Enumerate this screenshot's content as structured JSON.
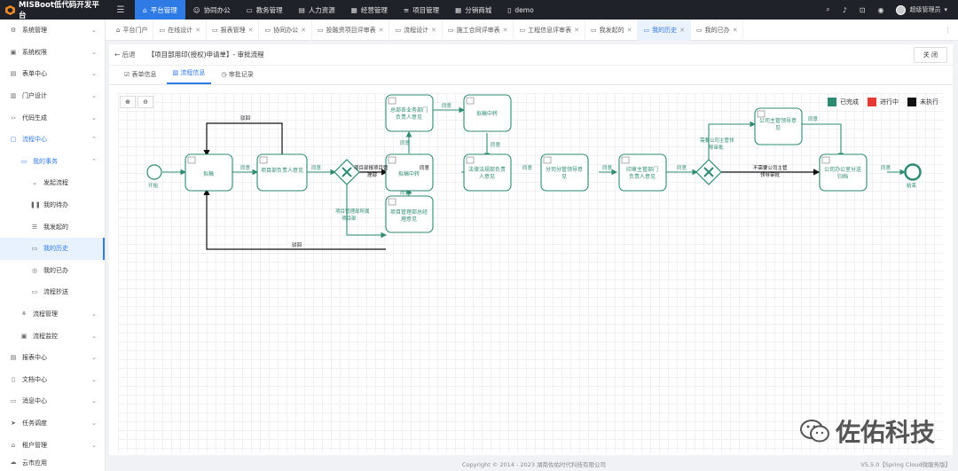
{
  "app": {
    "title": "MISBoot低代码开发平台"
  },
  "topnav": {
    "items": [
      {
        "label": "平台管理",
        "icon": "home-icon"
      },
      {
        "label": "协同办公",
        "icon": "user-icon"
      },
      {
        "label": "教务管理",
        "icon": "monitor-icon"
      },
      {
        "label": "人力资源",
        "icon": "id-card-icon"
      },
      {
        "label": "经营管理",
        "icon": "calendar-icon"
      },
      {
        "label": "项目管理",
        "icon": "list-icon"
      },
      {
        "label": "分销商城",
        "icon": "grid-icon"
      },
      {
        "label": "demo",
        "icon": "document-icon"
      }
    ],
    "user": "超级管理员"
  },
  "sidebar": {
    "items": [
      {
        "label": "系统管理"
      },
      {
        "label": "系统权限"
      },
      {
        "label": "表单中心"
      },
      {
        "label": "门户设计"
      },
      {
        "label": "代码生成"
      },
      {
        "label": "流程中心"
      },
      {
        "label": "我的事务"
      },
      {
        "label": "发起流程"
      },
      {
        "label": "我的待办"
      },
      {
        "label": "我发起的"
      },
      {
        "label": "我的历史"
      },
      {
        "label": "我的已办"
      },
      {
        "label": "流程抄送"
      },
      {
        "label": "流程管理"
      },
      {
        "label": "流程监控"
      },
      {
        "label": "报表中心"
      },
      {
        "label": "文档中心"
      },
      {
        "label": "消息中心"
      },
      {
        "label": "任务调度"
      },
      {
        "label": "租户管理"
      },
      {
        "label": "云市应用"
      }
    ]
  },
  "tabs": [
    {
      "label": "平台门户"
    },
    {
      "label": "在线设计"
    },
    {
      "label": "报表管理"
    },
    {
      "label": "协同办公"
    },
    {
      "label": "投融资项目评审表"
    },
    {
      "label": "流程设计"
    },
    {
      "label": "施工合同评审表"
    },
    {
      "label": "工程信息评审表"
    },
    {
      "label": "我发起的"
    },
    {
      "label": "我的历史"
    },
    {
      "label": "我的已办"
    }
  ],
  "page": {
    "back": "后退",
    "title": "【项目部用印(授权)申请单】- 审批流程",
    "close": "关 闭"
  },
  "subtabs": [
    {
      "label": "表单信息"
    },
    {
      "label": "流程信息"
    },
    {
      "label": "审批记录"
    }
  ],
  "legend": [
    {
      "label": "已完成",
      "color": "#2e8b72"
    },
    {
      "label": "进行中",
      "color": "#e53935"
    },
    {
      "label": "未执行",
      "color": "#111111"
    }
  ],
  "flow": {
    "start": "开始",
    "end": "结束",
    "tasks": {
      "t1": "拟稿",
      "t2": "项目部负责人意见",
      "t3a": "总部各业务部门",
      "t3b": "负责人意见",
      "t4": "拟稿中转",
      "t5": "拟稿中转",
      "t6a": "项目管理部总经",
      "t6b": "理意见",
      "t7a": "法律法规部负责",
      "t7b": "人意见",
      "t8a": "分司分管领导意",
      "t8b": "见",
      "t9a": "印章主管部门",
      "t9b": "负责人意见",
      "t10a": "公司主管领导意",
      "t10b": "见",
      "t11a": "公司办公室分送",
      "t11b": "归档"
    },
    "labels": {
      "reject1": "驳回",
      "reject2": "驳回",
      "agree": "同意",
      "cond1a": "项目部报项目管",
      "cond1b": "理部",
      "cond2a": "项目管理部所属",
      "cond2b": "项目部",
      "cond3a": "需要公司主管领",
      "cond3b": "导审批",
      "cond4a": "不需要公司主管",
      "cond4b": "领导审批"
    }
  },
  "footer": {
    "copy": "Copyright © 2014 - 2023 湖南佐佑时代科技有限公司",
    "version": "V5.5.0【Spring Cloud微服务版】"
  },
  "watermark": "佐佑科技"
}
